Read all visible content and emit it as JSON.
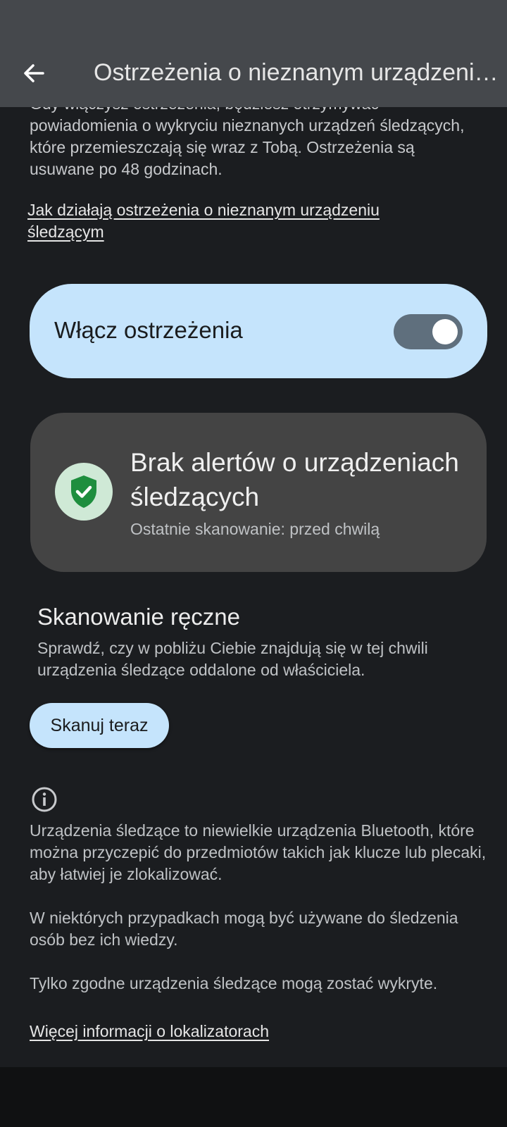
{
  "appbar": {
    "title": "Ostrzeżenia o nieznanym urządzeniu śledzącym",
    "back_icon": "arrow-back-icon"
  },
  "intro": {
    "text": "Gdy włączysz ostrzeżenia, będziesz otrzymywać powiadomienia o wykryciu nieznanych urządzeń śledzących, które przemieszczają się wraz z Tobą. Ostrzeżenia są usuwane po 48 godzinach.",
    "learn_link": "Jak działają ostrzeżenia o nieznanym urządzeniu śledzącym"
  },
  "toggle": {
    "label": "Włącz ostrzeżenia",
    "state": "on"
  },
  "status": {
    "icon": "shield-check-icon",
    "title": "Brak alertów o urządzeniach śledzących",
    "subtitle": "Ostatnie skanowanie: przed chwilą"
  },
  "manual_scan": {
    "title": "Skanowanie ręczne",
    "description": "Sprawdź, czy w pobliżu Ciebie znajdują się w tej chwili urządzenia śledzące oddalone od właściciela.",
    "button": "Skanuj teraz"
  },
  "info": {
    "icon": "info-icon",
    "paragraph1": "Urządzenia śledzące to niewielkie urządzenia Bluetooth, które można przyczepić do przedmiotów takich jak klucze lub plecaki, aby łatwiej je zlokalizować.",
    "paragraph2": "W niektórych przypadkach mogą być używane do śledzenia osób bez ich wiedzy.",
    "paragraph3": "Tylko zgodne urządzenia śledzące mogą zostać wykryte.",
    "more_link": "Więcej informacji o lokalizatorach"
  },
  "colors": {
    "appbar_bg": "#45484c",
    "page_bg": "#1b1d20",
    "accent_container": "#c5e4fc",
    "status_card_bg": "#444444",
    "shield_green": "#1e8e3e"
  }
}
